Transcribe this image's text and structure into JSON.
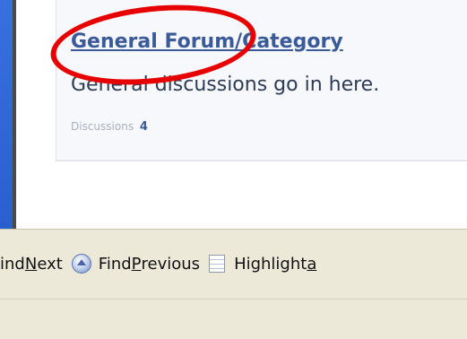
{
  "forum": {
    "title": "General Forum/Category",
    "description": "General discussions go in here.",
    "discussions_label": "Discussions",
    "discussions_count": "4"
  },
  "findbar": {
    "find_next": {
      "before": "ind ",
      "accel": "N",
      "after": "ext"
    },
    "find_previous": {
      "before": "Find ",
      "accel": "P",
      "after": "revious"
    },
    "highlight": {
      "before": "Highlight ",
      "accel": "a",
      "after": ""
    }
  },
  "colors": {
    "annotation": "#e60000",
    "link": "#3b5a9a",
    "desktop": "#2a5bd3"
  },
  "icons": [
    "find-previous-icon",
    "highlight-icon"
  ]
}
